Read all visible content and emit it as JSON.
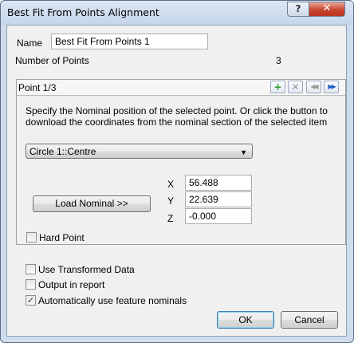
{
  "window": {
    "title": "Best Fit From Points Alignment",
    "help_label": "?",
    "close_label": "✕"
  },
  "name_field": {
    "label": "Name",
    "value": "Best Fit From Points 1"
  },
  "points": {
    "label": "Number of Points",
    "count": "3"
  },
  "point_panel": {
    "header": "Point 1/3",
    "toolbar": {
      "add_icon": "+",
      "delete_icon": "✕",
      "prev_icon": "◀◀",
      "next_icon": "▶▶"
    },
    "instructions_line1": "Specify the Nominal position of the selected point. Or click the button to",
    "instructions_line2": "download the coordinates from the nominal section of the selected item",
    "feature_select": {
      "value": "Circle 1::Centre",
      "arrow": "▼"
    },
    "load_button": "Load Nominal >>",
    "coords": {
      "x_label": "X",
      "x_value": "56.488",
      "y_label": "Y",
      "y_value": "22.639",
      "z_label": "Z",
      "z_value": "-0.000"
    },
    "hard_point": {
      "label": "Hard Point",
      "checked": false
    }
  },
  "options": {
    "use_transformed": {
      "label": "Use Transformed Data",
      "checked": false
    },
    "output_report": {
      "label": "Output in report",
      "checked": false
    },
    "auto_nominals": {
      "label": "Automatically use feature nominals",
      "checked": true,
      "mark": "✓"
    }
  },
  "buttons": {
    "ok": "OK",
    "cancel": "Cancel"
  },
  "colors": {
    "frame": "#cfdcec",
    "client": "#f0f0f0",
    "add_green": "#2e9a2e",
    "nav_blue": "#1f5fbf",
    "disabled": "#9a9a9a"
  }
}
